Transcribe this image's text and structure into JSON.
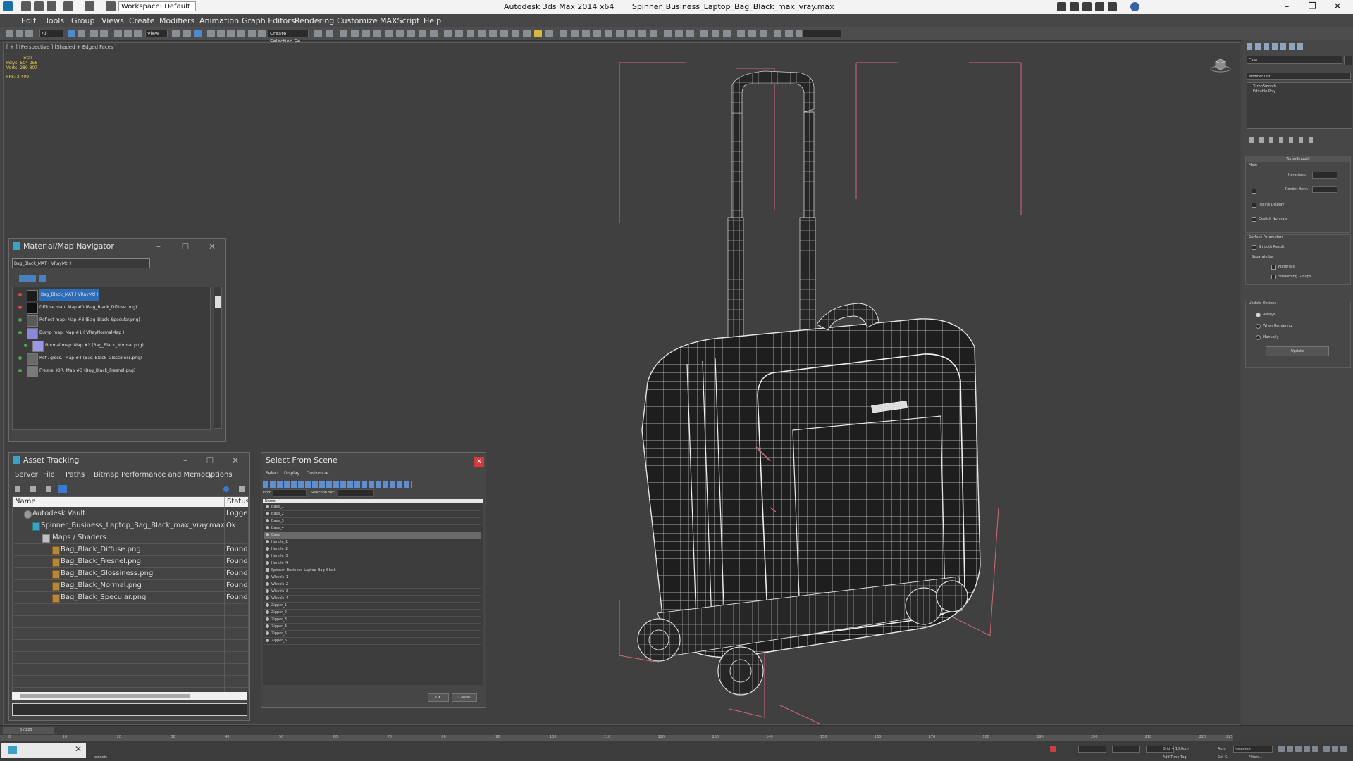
{
  "app": {
    "title": "Autodesk 3ds Max  2014 x64",
    "file": "Spinner_Business_Laptop_Bag_Black_max_vray.max",
    "workspace": "Workspace: Default"
  },
  "menu": [
    "Edit",
    "Tools",
    "Group",
    "Views",
    "Create",
    "Modifiers",
    "Animation",
    "Graph Editors",
    "Rendering",
    "Customize",
    "MAXScript",
    "Help"
  ],
  "toolbar": {
    "filter_value": "All",
    "view_value": "View",
    "selection_set": "Create Selection Se"
  },
  "viewport": {
    "label": "[ + ] [Perspective ] [Shaded + Edged Faces ]",
    "stats_total": "Total",
    "polys_label": "Polys:",
    "polys_value": "504 256",
    "verts_label": "Verts:",
    "verts_value": "280 307",
    "fps_label": "FPS:",
    "fps_value": "2,409"
  },
  "material_navigator": {
    "title": "Material/Map Navigator",
    "field_value": "Bag_Black_MAT  ( VRayMtl )",
    "items": [
      {
        "label": "Bag_Black_MAT  ( VRayMtl )",
        "color": "#1c1c1c",
        "dot": "#d44444"
      },
      {
        "label": "Diffuse map: Map #0 (Bag_Black_Diffuse.png)",
        "color": "#111111",
        "dot": "#d44444"
      },
      {
        "label": "Reflect map: Map #3 (Bag_Black_Specular.png)",
        "color": "#5a5a5a",
        "dot": "#4aa84a"
      },
      {
        "label": "Bump map: Map #1  ( VRayNormalMap )",
        "color": "#8a88d8",
        "dot": "#4aa84a"
      },
      {
        "label": "Normal map: Map #2 (Bag_Black_Normal.png)",
        "color": "#9a98e6",
        "dot": "#4aa84a"
      },
      {
        "label": "Refl. gloss.: Map #4 (Bag_Black_Glossiness.png)",
        "color": "#6a6a6a",
        "dot": "#4aa84a"
      },
      {
        "label": "Fresnel IOR: Map #3 (Bag_Black_Fresnel.png)",
        "color": "#7a7a7a",
        "dot": "#4aa84a"
      }
    ]
  },
  "asset_tracking": {
    "title": "Asset Tracking",
    "menu": [
      "Server",
      "File",
      "Paths",
      "Bitmap Performance and Memory",
      "Options"
    ],
    "col_name": "Name",
    "col_status": "Status",
    "rows": [
      {
        "name": "Autodesk Vault",
        "status": "Logge...",
        "indent": 26
      },
      {
        "name": "Spinner_Business_Laptop_Bag_Black_max_vray.max",
        "status": "Ok",
        "indent": 40
      },
      {
        "name": "Maps / Shaders",
        "status": "",
        "indent": 56
      },
      {
        "name": "Bag_Black_Diffuse.png",
        "status": "Found",
        "indent": 68
      },
      {
        "name": "Bag_Black_Fresnel.png",
        "status": "Found",
        "indent": 68
      },
      {
        "name": "Bag_Black_Glossiness.png",
        "status": "Found",
        "indent": 68
      },
      {
        "name": "Bag_Black_Normal.png",
        "status": "Found",
        "indent": 68
      },
      {
        "name": "Bag_Black_Specular.png",
        "status": "Found",
        "indent": 68
      }
    ]
  },
  "select_from_scene": {
    "title": "Select From Scene",
    "menu": [
      "Select",
      "Display",
      "Customize"
    ],
    "find_label": "Find:",
    "selection_set_label": "Selection Set:",
    "col_name": "Name",
    "items": [
      "Base_1",
      "Base_2",
      "Base_3",
      "Base_4",
      "Case",
      "Handle_1",
      "Handle_2",
      "Handle_3",
      "Handle_4",
      "Spinner_Business_Laptop_Bag_Black",
      "Wheels_1",
      "Wheels_2",
      "Wheels_3",
      "Wheels_4",
      "Zipper_1",
      "Zipper_2",
      "Zipper_3",
      "Zipper_4",
      "Zipper_5",
      "Zipper_6"
    ],
    "selected_index": 4,
    "ok_label": "OK",
    "cancel_label": "Cancel"
  },
  "command_panel": {
    "object_name": "Case",
    "modifier_list": "Modifier List",
    "stack": [
      "TurboSmooth",
      "Editable Poly"
    ],
    "rollout_title": "TurboSmooth",
    "main_label": "Main",
    "iterations_label": "Iterations:",
    "render_iters_label": "Render Iters:",
    "isoline_label": "Isoline Display",
    "explicit_normals_label": "Explicit Normals",
    "surface_params_label": "Surface Parameters",
    "smooth_result_label": "Smooth Result",
    "separate_by_label": "Separate by:",
    "materials_label": "Materials",
    "smoothing_groups_label": "Smoothing Groups",
    "update_options_label": "Update Options",
    "always_label": "Always",
    "when_rendering_label": "When Rendering",
    "manually_label": "Manually",
    "update_button": "Update"
  },
  "timeline": {
    "frame_label": "0 / 225",
    "ticks": [
      "0",
      "10",
      "20",
      "30",
      "40",
      "50",
      "60",
      "70",
      "80",
      "90",
      "100",
      "110",
      "120",
      "130",
      "140",
      "150",
      "160",
      "170",
      "180",
      "190",
      "200",
      "210",
      "220",
      "225"
    ]
  },
  "status": {
    "objects_text": "objects",
    "grid_text": "Grid = 10,0cm",
    "add_time_tag": "Add Time Tag",
    "auto_label": "Auto",
    "set_key_label": "Set K.",
    "selected_value": "Selected",
    "filters_label": "Filters..."
  }
}
